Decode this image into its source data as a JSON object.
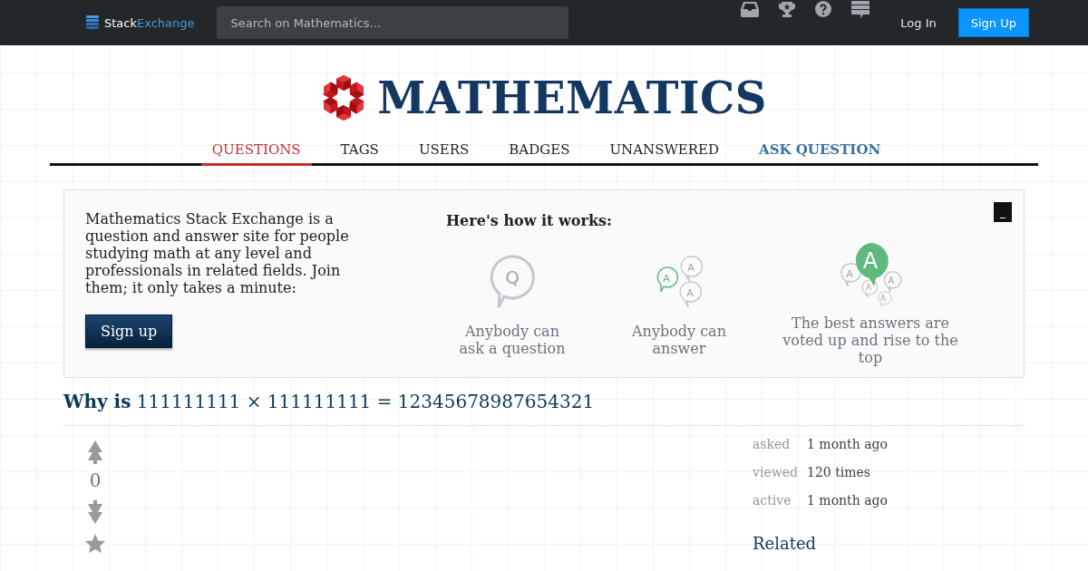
{
  "topbar": {
    "logo": {
      "part_1": "Stack",
      "part_2": "Exchange"
    },
    "search": {
      "placeholder": "Search on Mathematics…"
    },
    "login": "Log In",
    "signup": "Sign Up"
  },
  "site": {
    "title": "MATHEMATICS"
  },
  "nav": [
    {
      "label": "QUESTIONS",
      "selected": true,
      "kind": "tab"
    },
    {
      "label": "TAGS",
      "selected": false,
      "kind": "tab"
    },
    {
      "label": "USERS",
      "selected": false,
      "kind": "tab"
    },
    {
      "label": "BADGES",
      "selected": false,
      "kind": "tab"
    },
    {
      "label": "UNANSWERED",
      "selected": false,
      "kind": "tab"
    },
    {
      "label": "ASK QUESTION",
      "selected": false,
      "kind": "action"
    }
  ],
  "welcome": {
    "text": "Mathematics Stack Exchange is a question and answer site for people studying math at any level and professionals in related fields. Join them; it only takes a minute:",
    "signup": "Sign up",
    "how_title": "Here's how it works:",
    "close": "_",
    "steps": [
      {
        "kind": "ask",
        "letters": [
          "Q"
        ],
        "caption": "Anybody can ask a question"
      },
      {
        "kind": "answer",
        "letters": [
          "A",
          "A",
          "A"
        ],
        "caption": "Anybody can answer"
      },
      {
        "kind": "best",
        "letters": [
          "A",
          "A",
          "A",
          "A",
          "A"
        ],
        "caption": "The best answers are voted up and rise to the top"
      }
    ]
  },
  "question": {
    "title": "**Why is** 111111111 × 111111111 = 12345678987654321",
    "score": "0"
  },
  "stats": [
    {
      "label": "asked",
      "value": "1 month ago"
    },
    {
      "label": "viewed",
      "value": "120 times"
    },
    {
      "label": "active",
      "value": "1 month ago"
    }
  ],
  "related": {
    "title": "Related"
  }
}
